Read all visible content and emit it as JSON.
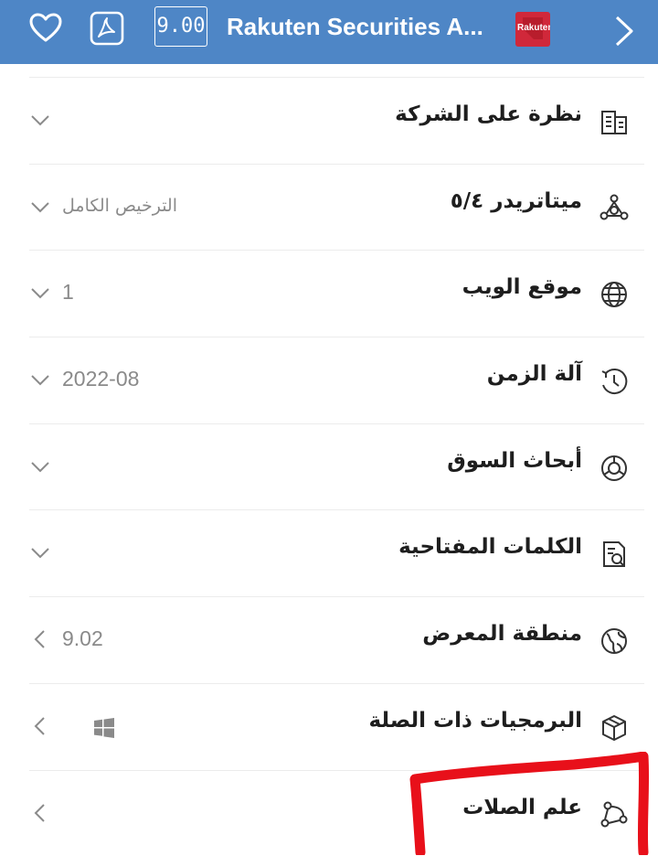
{
  "header": {
    "score": "9.00",
    "title": "Rakuten Securities A...",
    "logo_text": "Rakuten",
    "icons": [
      "heart-icon",
      "pdf-icon",
      "chevron-right-icon"
    ]
  },
  "rows": [
    {
      "label": "نظرة على الشركة",
      "value": "",
      "icon": "building-icon",
      "chevron": "down"
    },
    {
      "label": "ميتاتريدر ٥/٤",
      "value": "الترخيص الكامل",
      "icon": "metatrader-icon",
      "chevron": "down"
    },
    {
      "label": "موقع الويب",
      "value": "1",
      "icon": "globe-icon",
      "chevron": "down"
    },
    {
      "label": "آلة الزمن",
      "value": "2022-08",
      "icon": "time-machine-icon",
      "chevron": "down"
    },
    {
      "label": "أبحاث السوق",
      "value": "",
      "icon": "market-research-icon",
      "chevron": "down"
    },
    {
      "label": "الكلمات المفتاحية",
      "value": "",
      "icon": "keywords-icon",
      "chevron": "down"
    },
    {
      "label": "منطقة المعرض",
      "value": "9.02",
      "icon": "region-icon",
      "chevron": "left"
    },
    {
      "label": "البرمجيات ذات الصلة",
      "value": "",
      "icon": "software-box-icon",
      "chevron": "left"
    },
    {
      "label": "علم الصلات",
      "value": "",
      "icon": "relations-icon",
      "chevron": "left"
    }
  ],
  "colors": {
    "header_bg": "#4e86c6",
    "annotation": "#e8101a",
    "logo_bg": "#d0283a"
  }
}
